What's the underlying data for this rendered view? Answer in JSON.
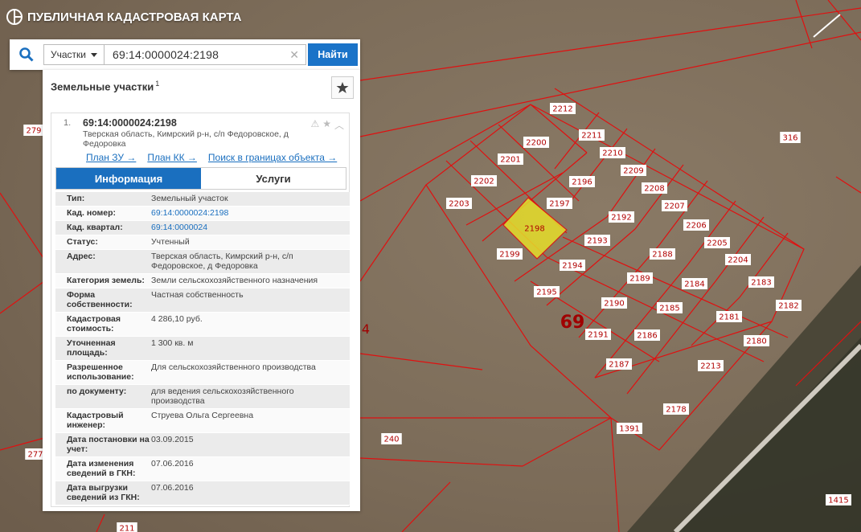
{
  "app": {
    "title": "ПУБЛИЧНАЯ КАДАСТРОВАЯ КАРТА"
  },
  "search": {
    "type_label": "Участки",
    "query": "69:14:0000024:2198",
    "find_label": "Найти"
  },
  "panel": {
    "title": "Земельные участки",
    "count": "1",
    "result": {
      "index": "1.",
      "number": "69:14:0000024:2198",
      "address_short": "Тверская область, Кимрский р-н, с/п Федоровское, д Федоровка",
      "links": [
        "План ЗУ →",
        "План КК →",
        "Поиск в границах объекта →"
      ]
    },
    "tabs": [
      {
        "label": "Информация",
        "active": true
      },
      {
        "label": "Услуги",
        "active": false
      }
    ],
    "info": [
      {
        "k": "Тип:",
        "v": "Земельный участок"
      },
      {
        "k": "Кад. номер:",
        "v": "69:14:0000024:2198",
        "link": true
      },
      {
        "k": "Кад. квартал:",
        "v": "69:14:0000024",
        "link": true
      },
      {
        "k": "Статус:",
        "v": "Учтенный"
      },
      {
        "k": "Адрес:",
        "v": "Тверская область, Кимрский р-н, с/п Федоровское, д Федоровка"
      },
      {
        "k": "Категория земель:",
        "v": "Земли сельскохозяйственного назначения"
      },
      {
        "k": "Форма собственности:",
        "v": "Частная собственность"
      },
      {
        "k": "Кадастровая стоимость:",
        "v": "4 286,10 руб."
      },
      {
        "k": "Уточненная площадь:",
        "v": "1 300 кв. м"
      },
      {
        "k": "Разрешенное использование:",
        "v": "Для сельскохозяйственного производства"
      },
      {
        "k": "по документу:",
        "v": "для ведения сельскохозяйственного производства"
      },
      {
        "k": "Кадастровый инженер:",
        "v": "Струева Ольга Сергеевна"
      },
      {
        "k": "Дата постановки на учет:",
        "v": "03.09.2015"
      },
      {
        "k": "Дата изменения сведений в ГКН:",
        "v": "07.06.2016"
      },
      {
        "k": "Дата выгрузки сведений из ГКН:",
        "v": "07.06.2016"
      }
    ]
  },
  "map": {
    "quarter_label": "69",
    "partial_label": "4",
    "parcels": [
      "2212",
      "2200",
      "2211",
      "2201",
      "2210",
      "2202",
      "2196",
      "2209",
      "2203",
      "2197",
      "2208",
      "2192",
      "2198",
      "2207",
      "2206",
      "2193",
      "2199",
      "2188",
      "2205",
      "2194",
      "2204",
      "2189",
      "2184",
      "2183",
      "2195",
      "2190",
      "2185",
      "2182",
      "2191",
      "2186",
      "2181",
      "2180",
      "2187",
      "2213",
      "2178",
      "1391",
      "240",
      "316",
      "279",
      "277",
      "1415",
      "211"
    ],
    "colors": {
      "boundary": "#e01010",
      "highlight": "#e6dd2a",
      "accent": "#1a6fbf"
    }
  }
}
